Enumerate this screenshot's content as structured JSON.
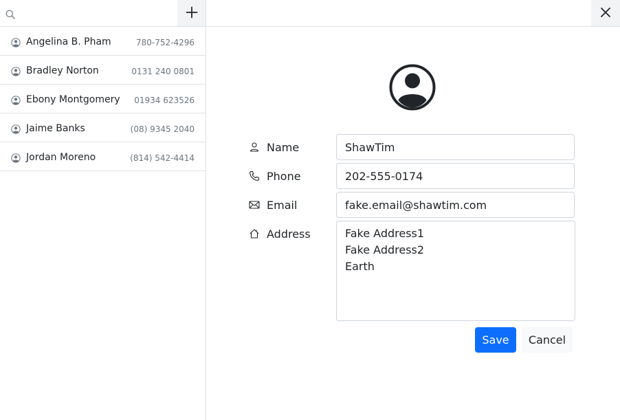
{
  "search": {
    "placeholder": "",
    "value": "",
    "icon": "search-icon"
  },
  "sidebar": {
    "add_button_icon": "plus-icon",
    "contacts": [
      {
        "name": "Angelina B. Pham",
        "phone": "780-752-4296"
      },
      {
        "name": "Bradley Norton",
        "phone": "0131 240 0801"
      },
      {
        "name": "Ebony Montgomery",
        "phone": "01934 623526"
      },
      {
        "name": "Jaime Banks",
        "phone": "(08) 9345 2040"
      },
      {
        "name": "Jordan Moreno",
        "phone": "(814) 542-4414"
      }
    ]
  },
  "detail": {
    "close_icon": "close-icon",
    "avatar_icon": "person-circle-icon",
    "fields": {
      "name": {
        "label": "Name",
        "value": "ShawTim",
        "icon": "person-icon"
      },
      "phone": {
        "label": "Phone",
        "value": "202-555-0174",
        "icon": "phone-icon"
      },
      "email": {
        "label": "Email",
        "value": "fake.email@shawtim.com",
        "icon": "envelope-icon"
      },
      "address": {
        "label": "Address",
        "value": "Fake Address1\nFake Address2\nEarth",
        "icon": "house-icon"
      }
    },
    "save_label": "Save",
    "cancel_label": "Cancel"
  },
  "colors": {
    "primary": "#0d6efd",
    "border": "#dee2e6",
    "muted_text": "#6c757d",
    "text": "#212529"
  }
}
